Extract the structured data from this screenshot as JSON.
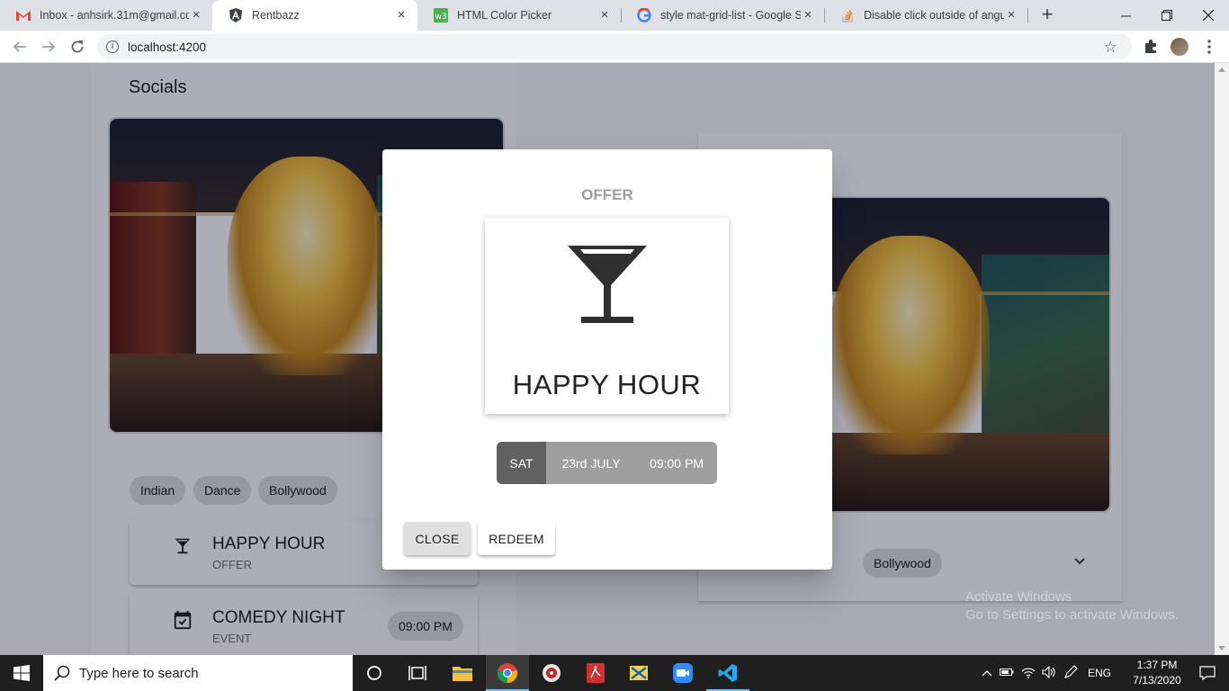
{
  "browser": {
    "tabs": [
      {
        "label": "Inbox - anhsirk.31m@gmail.co",
        "icon": "gmail-icon"
      },
      {
        "label": "Rentbazz",
        "icon": "angular-icon"
      },
      {
        "label": "HTML Color Picker",
        "icon": "w3schools-icon"
      },
      {
        "label": "style mat-grid-list - Google Se",
        "icon": "google-icon"
      },
      {
        "label": "Disable click outside of angula",
        "icon": "stackoverflow-icon"
      }
    ],
    "tab_close": "×",
    "new_tab": "+",
    "url": "localhost:4200"
  },
  "left_panel": {
    "title": "Socials",
    "chips": [
      "Indian",
      "Dance",
      "Bollywood"
    ],
    "cards": [
      {
        "title": "HAPPY HOUR",
        "subtitle": "OFFER",
        "icon": "cocktail-icon"
      },
      {
        "title": "COMEDY NIGHT",
        "subtitle": "EVENT",
        "time": "09:00 PM",
        "icon": "event-icon"
      }
    ]
  },
  "right_panel": {
    "chips": [
      "Bollywood"
    ]
  },
  "dialog": {
    "title": "OFFER",
    "offer_name": "HAPPY HOUR",
    "day": "SAT",
    "date": "23rd JULY",
    "time": "09:00 PM",
    "close_label": "CLOSE",
    "redeem_label": "REDEEM"
  },
  "watermark": {
    "line1": "Activate Windows",
    "line2": "Go to Settings to activate Windows."
  },
  "taskbar": {
    "search_placeholder": "Type here to search",
    "language": "ENG",
    "time": "1:37 PM",
    "date": "7/13/2020"
  },
  "colors": {
    "overlay": "#00001e52",
    "datebar_day": "#616161",
    "datebar_rest": "#9e9e9e",
    "taskbar": "#1f1f1f"
  }
}
